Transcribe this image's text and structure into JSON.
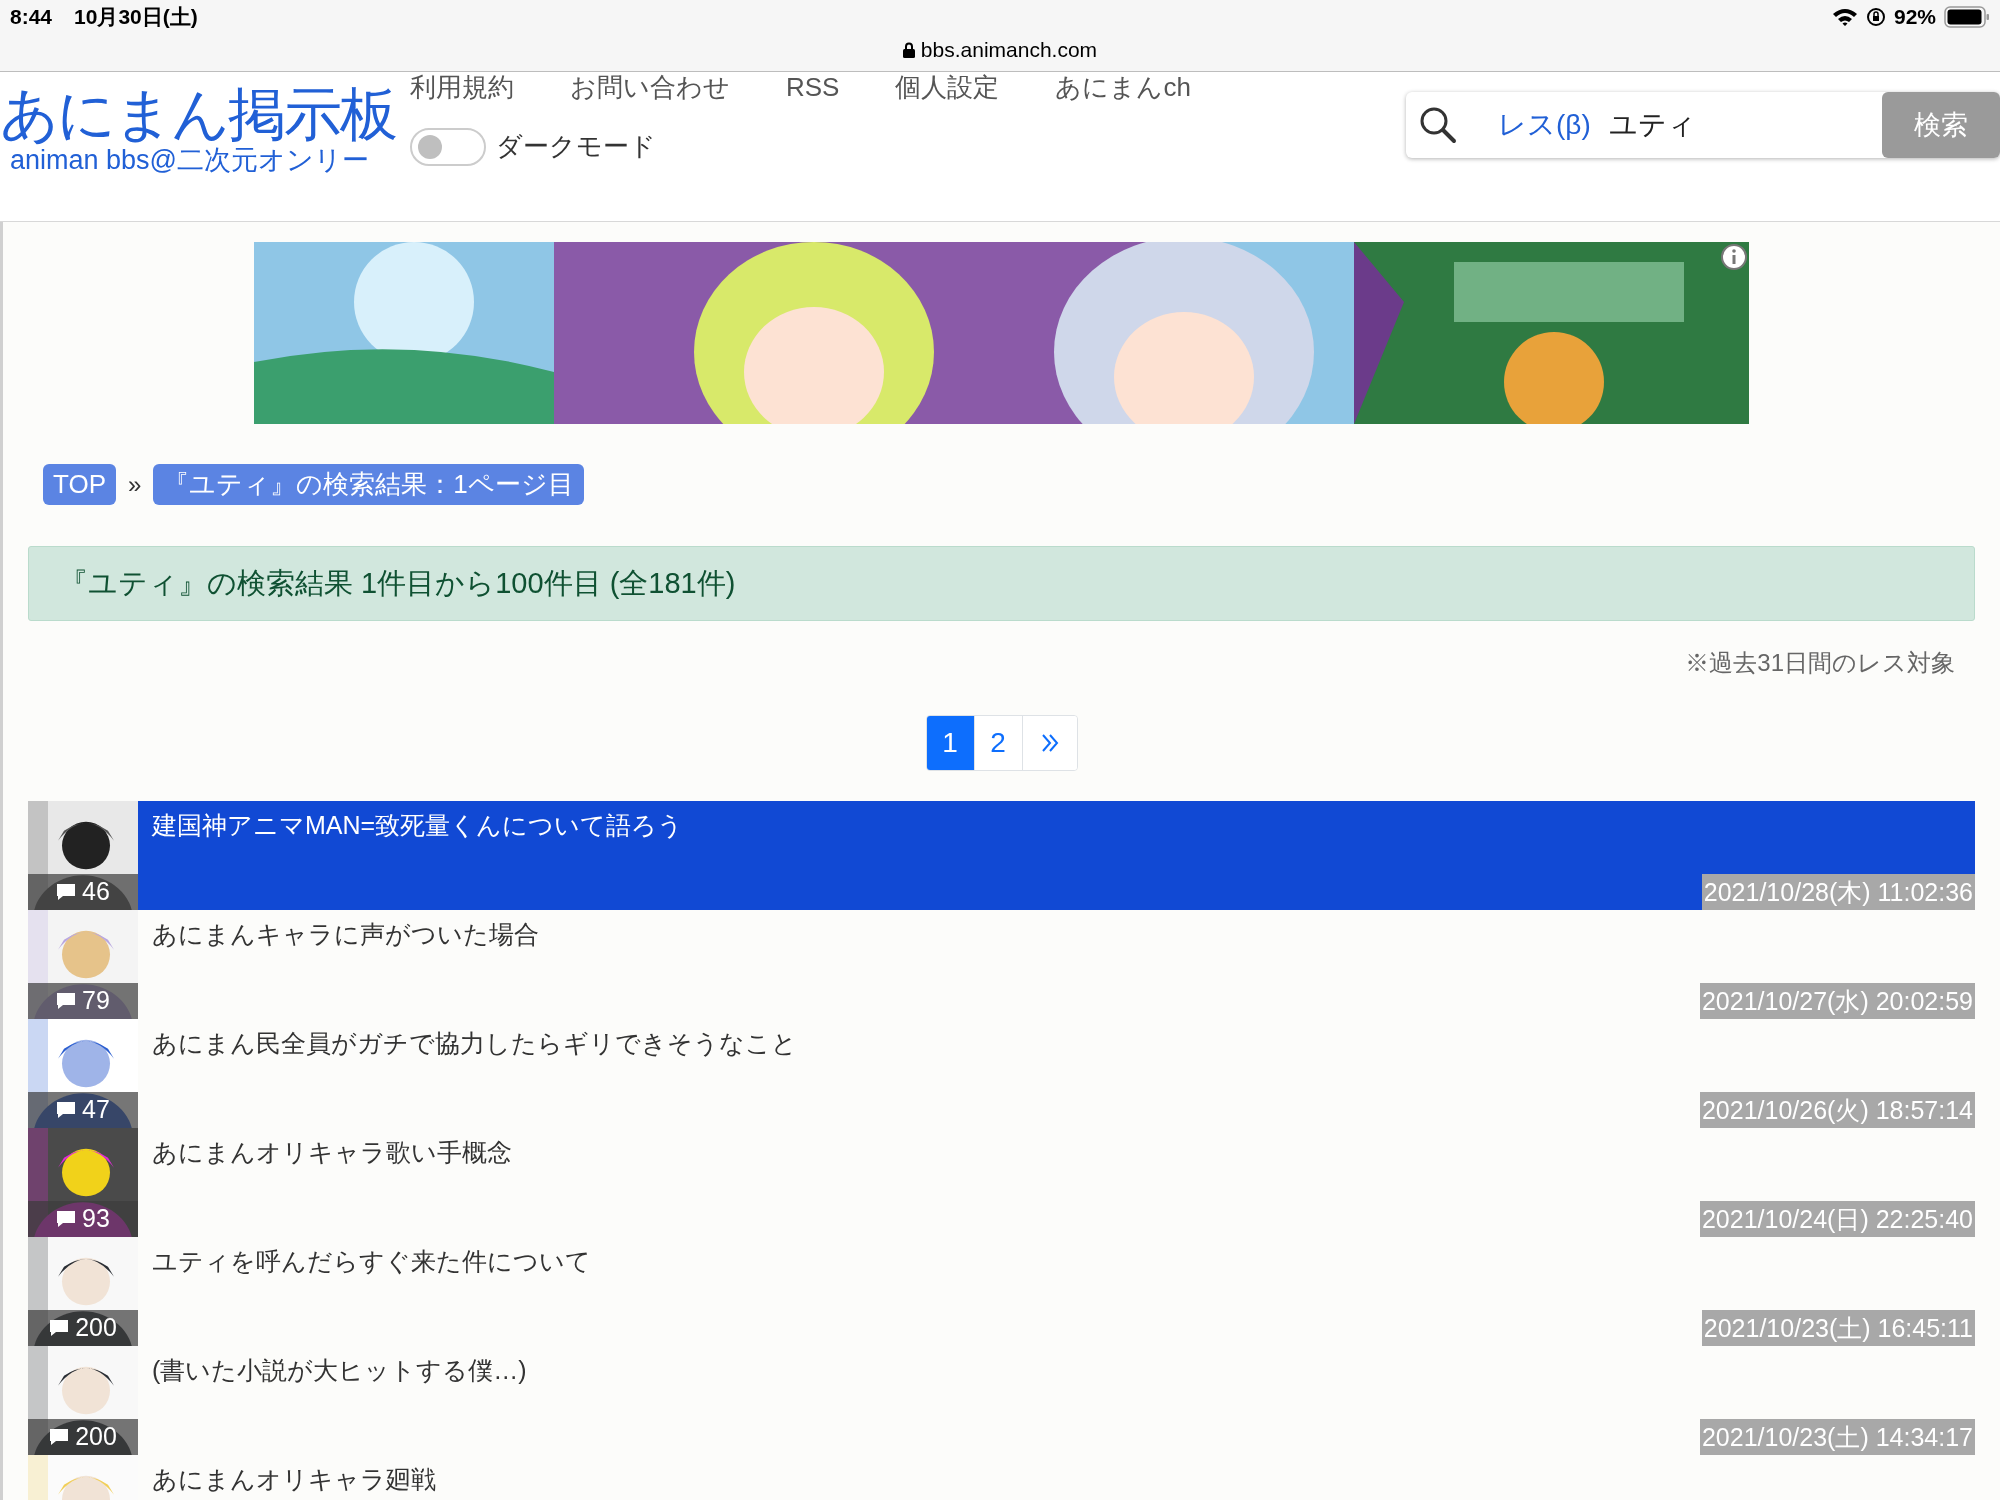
{
  "status_bar": {
    "time": "8:44",
    "date": "10月30日(土)",
    "battery": "92%"
  },
  "address_bar": {
    "url": "bbs.animanch.com"
  },
  "site": {
    "logo": "あにまん掲示板",
    "subtitle": "animan bbs@二次元オンリー"
  },
  "nav": [
    "利用規約",
    "お問い合わせ",
    "RSS",
    "個人設定",
    "あにまんch"
  ],
  "dark_mode": {
    "label": "ダークモード",
    "on": false
  },
  "search": {
    "scope": "レス(β)",
    "value": "ユティ",
    "button": "検索"
  },
  "breadcrumb": [
    "TOP",
    "『ユティ』の検索結果：1ページ目"
  ],
  "breadcrumb_separator": "»",
  "result_summary": "『ユティ』の検索結果 1件目から100件目 (全181件)",
  "note": "※過去31日間のレス対象",
  "pagination": [
    {
      "label": "1",
      "selected": true
    },
    {
      "label": "2",
      "selected": false
    }
  ],
  "threads": [
    {
      "title": "建国神アニマMAN=致死量くんについて語ろう",
      "count": "46",
      "date": "2021/10/28(木) 11:02:36",
      "selected": true
    },
    {
      "title": "あにまんキャラに声がついた場合",
      "count": "79",
      "date": "2021/10/27(水) 20:02:59",
      "selected": false
    },
    {
      "title": "あにまん民全員がガチで協力したらギリできそうなこと",
      "count": "47",
      "date": "2021/10/26(火) 18:57:14",
      "selected": false
    },
    {
      "title": "あにまんオリキャラ歌い手概念",
      "count": "93",
      "date": "2021/10/24(日) 22:25:40",
      "selected": false
    },
    {
      "title": "ユティを呼んだらすぐ来た件について",
      "count": "200",
      "date": "2021/10/23(土) 16:45:11",
      "selected": false
    },
    {
      "title": "(書いた小説が大ヒットする僕…)",
      "count": "200",
      "date": "2021/10/23(土) 14:34:17",
      "selected": false
    },
    {
      "title": "あにまんオリキャラ廻戦",
      "selected": false
    }
  ]
}
